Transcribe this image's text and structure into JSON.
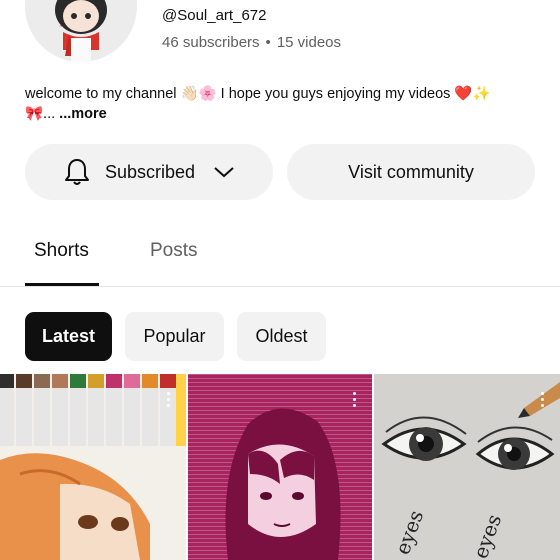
{
  "channel": {
    "handle": "@Soul_art_672",
    "subscribers": "46 subscribers",
    "separator": "•",
    "videos": "15 videos",
    "description": "welcome to my channel 👋🏻🌸 I hope you guys enjoying my videos ❤️✨",
    "description_line2": "🎀...",
    "more_label": "...more"
  },
  "actions": {
    "subscribed_label": "Subscribed",
    "community_label": "Visit community"
  },
  "tabs": {
    "shorts": "Shorts",
    "posts": "Posts",
    "active": "Shorts"
  },
  "filters": {
    "latest": "Latest",
    "popular": "Popular",
    "oldest": "Oldest",
    "selected": "Latest"
  },
  "shorts": [
    {
      "subject": "markers and orange-haired girl drawing"
    },
    {
      "subject": "magenta line-art girl portrait"
    },
    {
      "subject": "pencil eyes sketch",
      "caption": "eyes"
    }
  ],
  "colors": {
    "text_primary": "#0f0f0f",
    "text_secondary": "#606060",
    "chip_selected_bg": "#0f0f0f",
    "button_bg": "#f2f2f2"
  }
}
